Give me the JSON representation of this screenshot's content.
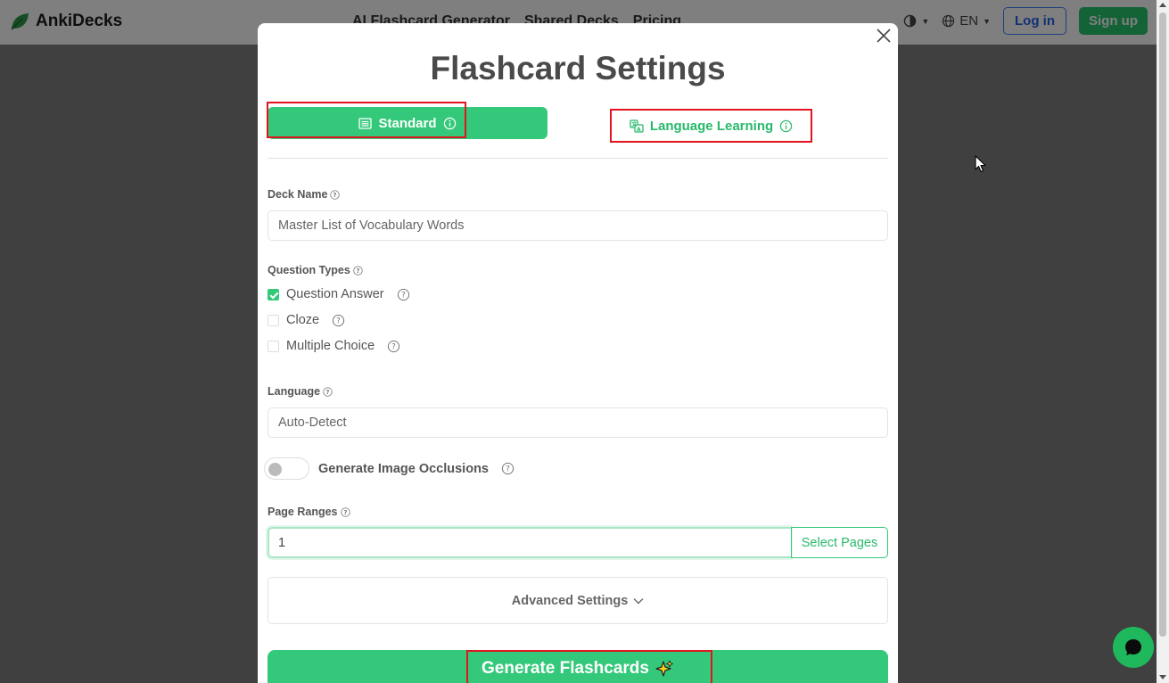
{
  "nav": {
    "brand": "AnkiDecks",
    "links": [
      "AI Flashcard Generator",
      "Shared Decks",
      "Pricing"
    ],
    "language": "EN",
    "login": "Log in",
    "signup": "Sign up"
  },
  "modal": {
    "title": "Flashcard Settings",
    "tabs": {
      "standard": "Standard",
      "language_learning": "Language Learning",
      "active": "Standard"
    },
    "deck_name": {
      "label": "Deck Name",
      "placeholder": "Master List of Vocabulary Words"
    },
    "question_types": {
      "label": "Question Types",
      "options": [
        {
          "label": "Question Answer",
          "checked": true
        },
        {
          "label": "Cloze",
          "checked": false
        },
        {
          "label": "Multiple Choice",
          "checked": false
        }
      ]
    },
    "language": {
      "label": "Language",
      "value": "Auto-Detect"
    },
    "image_occlusions": {
      "label": "Generate Image Occlusions",
      "enabled": false
    },
    "page_ranges": {
      "label": "Page Ranges",
      "value": "1",
      "select_button": "Select Pages"
    },
    "advanced_settings": "Advanced Settings",
    "generate_button": "Generate Flashcards"
  },
  "colors": {
    "accent": "#34c97a",
    "highlight_box": "#e0151f",
    "login_border": "#3b82f6"
  }
}
